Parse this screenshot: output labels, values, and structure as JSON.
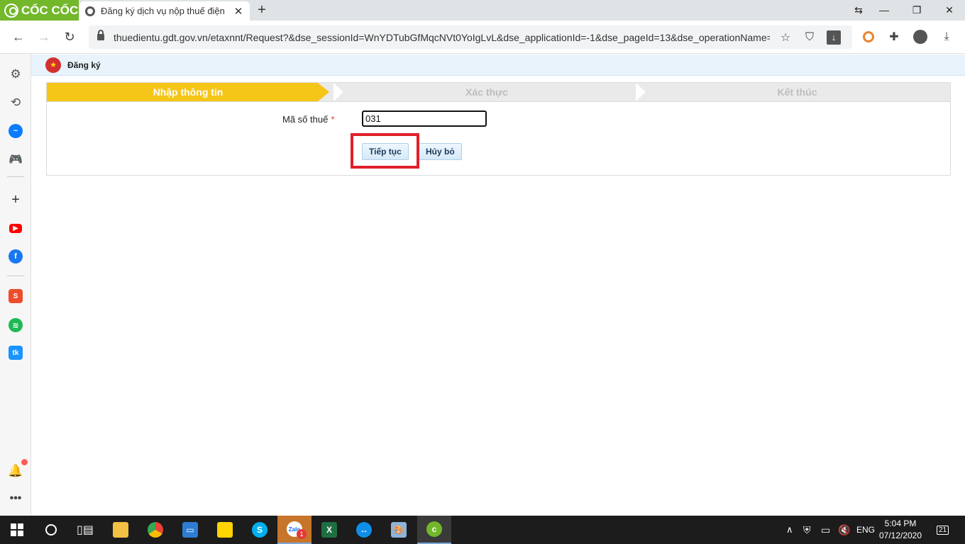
{
  "browser": {
    "brand": "CỐC CỐC",
    "tab_title": "Đăng ký dịch vụ nộp thuế điện tử",
    "tab_close": "✕",
    "new_tab": "+",
    "url": "thuedientu.gdt.gov.vn/etaxnnt/Request?&dse_sessionId=WnYDTubGfMqcNVt0YoIgLvL&dse_applicationId=-1&dse_pageId=13&dse_operationName=",
    "window_controls": {
      "tabs_search": "⇆",
      "minimize": "—",
      "restore": "❐",
      "close": "✕"
    }
  },
  "page": {
    "header_title": "Đăng ký",
    "steps": [
      "Nhập thông tin",
      "Xác thực",
      "Kết thúc"
    ],
    "active_step": 1,
    "form": {
      "tax_label": "Mã số thuế",
      "required_mark": "*",
      "tax_value": "031"
    },
    "buttons": {
      "continue": "Tiếp tục",
      "cancel": "Hủy bỏ"
    }
  },
  "taskbar": {
    "language": "ENG",
    "time": "5:04 PM",
    "date": "07/12/2020",
    "notification_count": "21",
    "zalo_badge": "1"
  },
  "colors": {
    "accent_yellow": "#f5c518",
    "highlight_red": "#e0202a",
    "coccoc_green": "#73b72b"
  }
}
